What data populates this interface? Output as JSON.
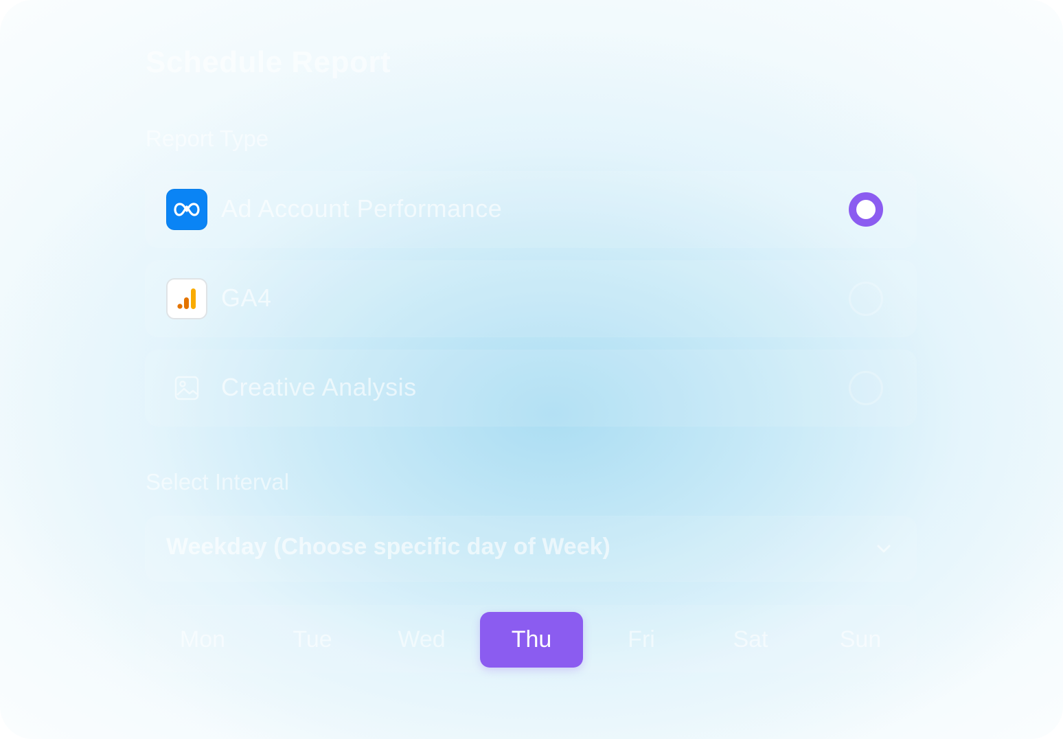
{
  "dialog": {
    "title": "Schedule Report"
  },
  "report_type": {
    "label": "Report Type",
    "selected_index": 0,
    "options": [
      {
        "label": "Ad Account Performance",
        "icon": "meta-logo-icon",
        "selected": true
      },
      {
        "label": "GA4",
        "icon": "google-analytics-icon",
        "selected": false
      },
      {
        "label": "Creative Analysis",
        "icon": "image-icon",
        "selected": false
      }
    ]
  },
  "interval": {
    "label": "Select Interval",
    "selected_value": "Weekday (Choose specific day of Week)",
    "chevron_icon": "chevron-down-icon"
  },
  "weekdays": {
    "days": [
      "Mon",
      "Tue",
      "Wed",
      "Thu",
      "Fri",
      "Sat",
      "Sun"
    ],
    "selected": "Thu"
  },
  "colors": {
    "accent": "#8b5cf0",
    "meta_blue": "#0a84f5",
    "ga_orange": "#f9ab00",
    "ga_dark_orange": "#e37400"
  }
}
